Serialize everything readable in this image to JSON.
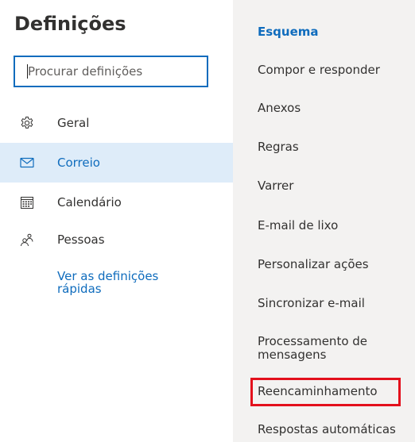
{
  "title": "Definições",
  "search": {
    "placeholder": "Procurar definições",
    "value": ""
  },
  "nav": [
    {
      "label": "Geral",
      "icon": "gear-icon"
    },
    {
      "label": "Correio",
      "icon": "mail-icon",
      "selected": true
    },
    {
      "label": "Calendário",
      "icon": "calendar-icon"
    },
    {
      "label": "Pessoas",
      "icon": "people-icon"
    }
  ],
  "quick_settings_link": "Ver as definições rápidas",
  "mail_sections": [
    {
      "label": "Esquema",
      "selected": true
    },
    {
      "label": "Compor e responder"
    },
    {
      "label": "Anexos"
    },
    {
      "label": "Regras"
    },
    {
      "label": "Varrer"
    },
    {
      "label": "E-mail de lixo"
    },
    {
      "label": "Personalizar ações"
    },
    {
      "label": "Sincronizar e-mail"
    },
    {
      "label": "Processamento de mensagens"
    },
    {
      "label": "Reencaminhamento",
      "highlighted": true
    },
    {
      "label": "Respostas automáticas"
    }
  ],
  "colors": {
    "accent": "#0f6cbd",
    "selected_background": "#deecf9",
    "pane_background": "#f3f2f1",
    "highlight_border": "#e3101c"
  }
}
